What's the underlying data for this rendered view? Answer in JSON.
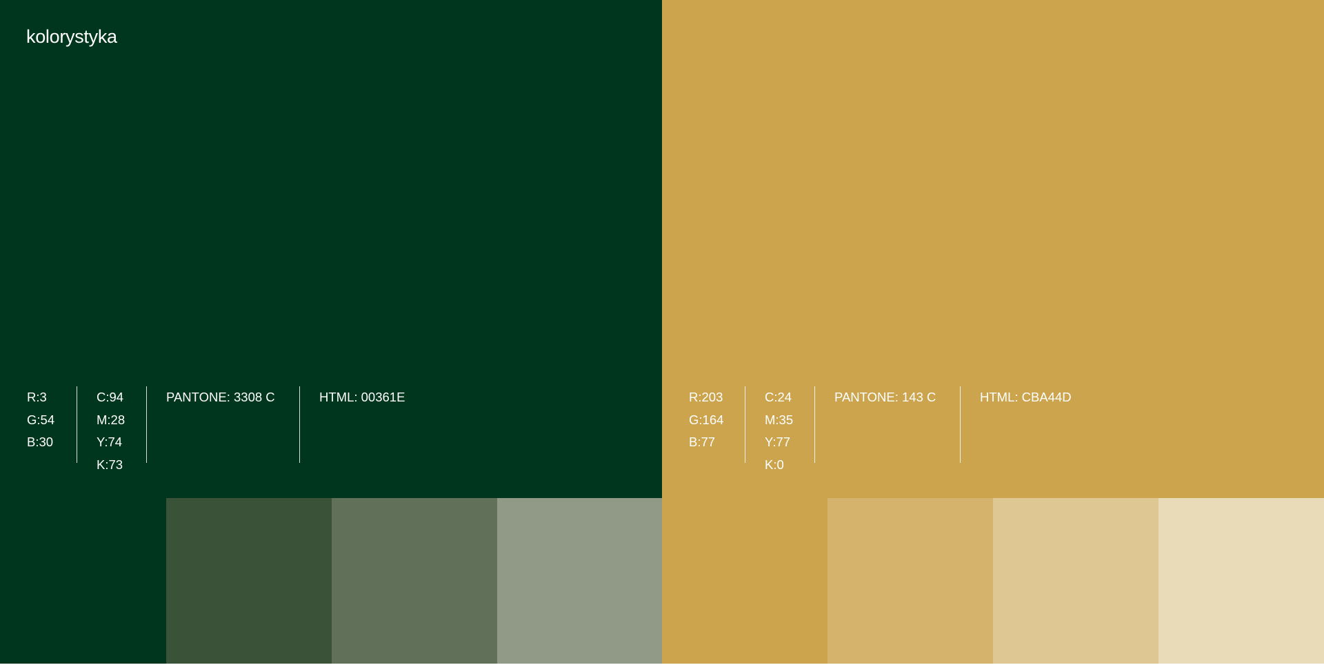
{
  "title": "kolorystyka",
  "palettes": [
    {
      "id": "green",
      "base_color": "#00361E",
      "rgb": [
        "R:3",
        "G:54",
        "B:30"
      ],
      "cmyk": [
        "C:94",
        "M:28",
        "Y:74",
        "K:73"
      ],
      "pantone": "PANTONE: 3308 C",
      "html": "HTML: 00361E",
      "tints": [
        "#3A5238",
        "#617059",
        "#919A87"
      ]
    },
    {
      "id": "gold",
      "base_color": "#CBA44D",
      "rgb": [
        "R:203",
        "G:164",
        "B:77"
      ],
      "cmyk": [
        "C:24",
        "M:35",
        "Y:77",
        "K:0"
      ],
      "pantone": "PANTONE: 143 C",
      "html": "HTML: CBA44D",
      "tints": [
        "#D6B36D",
        "#DFC793",
        "#E9DBB8"
      ]
    }
  ]
}
